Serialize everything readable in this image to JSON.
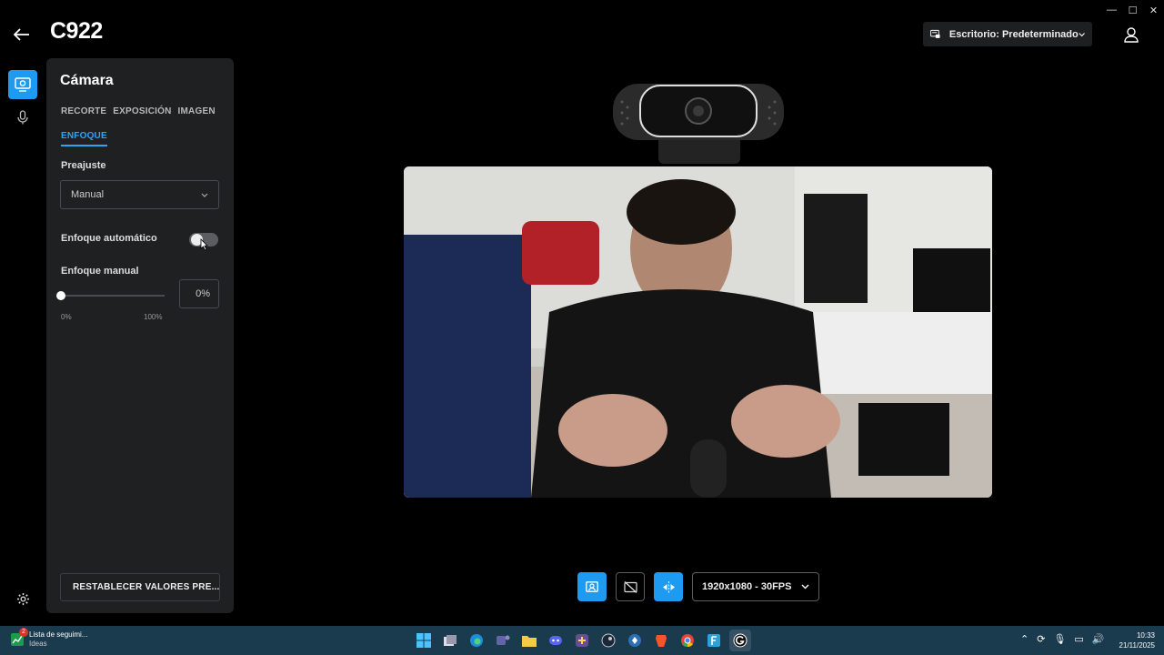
{
  "window": {
    "minimize": "—",
    "maximize": "☐",
    "close": "✕"
  },
  "header": {
    "title": "C922",
    "profile_selector": "Escritorio: Predeterminado"
  },
  "panel": {
    "title": "Cámara",
    "tabs": [
      "RECORTE",
      "EXPOSICIÓN",
      "IMAGEN",
      "ENFOQUE"
    ],
    "active_tab": "ENFOQUE",
    "preset": {
      "label": "Preajuste",
      "value": "Manual"
    },
    "autofocus": {
      "label": "Enfoque automático",
      "enabled": false
    },
    "manual_focus": {
      "label": "Enfoque manual",
      "value": "0%",
      "fraction": 0,
      "min_label": "0%",
      "max_label": "100%"
    },
    "reset_button": "RESTABLECER VALORES PRE..."
  },
  "controls": {
    "resolution": "1920x1080 - 30FPS"
  },
  "taskbar": {
    "widget_title": "Lista de seguimi...",
    "widget_subtitle": "Ideas",
    "widget_badge": "2",
    "time": "10:33",
    "date": "21/11/2025"
  },
  "colors": {
    "accent": "#1e9bf0",
    "panel_bg": "#1f2022",
    "taskbar_bg": "#1a3a4e"
  }
}
